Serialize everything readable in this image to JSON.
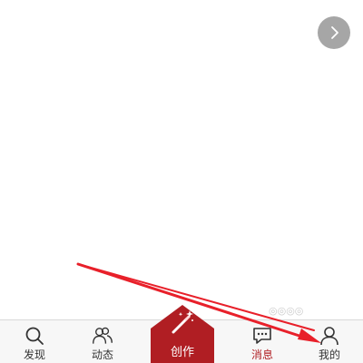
{
  "colors": {
    "accent": "#b01e23",
    "tabbar_background": "#f7f7f7",
    "next_button": "#a6a6a6",
    "annotation_arrow": "#e8202a"
  },
  "top": {
    "next_icon": "chevron-right-icon"
  },
  "tabbar": {
    "tabs": [
      {
        "label": "发现",
        "icon": "search-icon"
      },
      {
        "label": "动态",
        "icon": "users-icon"
      },
      {
        "label": "创作",
        "icon": "magic-wand-icon",
        "active": true
      },
      {
        "label": "消息",
        "icon": "chat-bubble-icon"
      },
      {
        "label": "我的",
        "icon": "user-icon"
      }
    ]
  },
  "annotation": {
    "type": "red-arrow",
    "points_to": "tab-me"
  }
}
